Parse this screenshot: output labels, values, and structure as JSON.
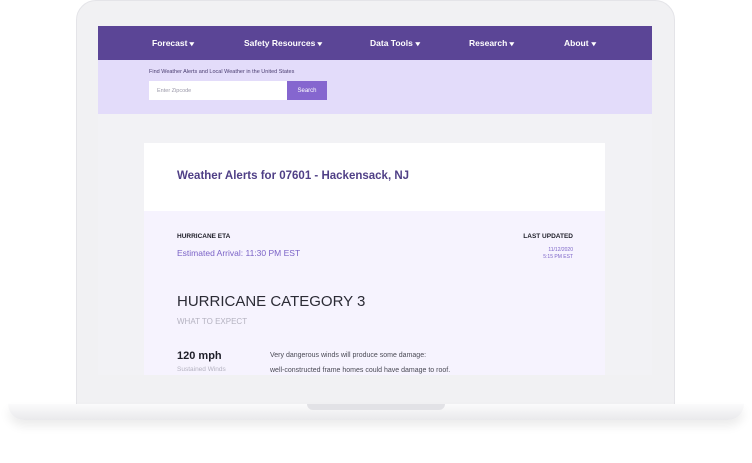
{
  "nav": {
    "items": [
      {
        "label": "Forecast"
      },
      {
        "label": "Safety Resources"
      },
      {
        "label": "Data Tools"
      },
      {
        "label": "Research"
      },
      {
        "label": "About"
      }
    ],
    "chevron": "▾"
  },
  "search": {
    "caption": "Find Weather Alerts and Local Weather in the United States",
    "placeholder": "Enter Zipcode",
    "button_label": "Search"
  },
  "alert": {
    "title": "Weather Alerts for 07601 - Hackensack, NJ",
    "eta_label": "HURRICANE ETA",
    "eta_value": "Estimated Arrival:  11:30  PM EST",
    "updated_label": "LAST UPDATED",
    "updated_date": "11/12/2020",
    "updated_time": "5:15 PM EST",
    "category_title": "HURRICANE CATEGORY 3",
    "category_subtitle": "WHAT TO EXPECT",
    "wind_value": "120 mph",
    "wind_caption": "Sustained Winds",
    "wind_desc_line1": "Very dangerous winds will produce some damage:",
    "wind_desc_line2": "well-constructed frame homes could have damage to roof."
  },
  "colors": {
    "nav_bg": "#5b4596",
    "search_band": "#e3dcfa",
    "accent": "#8566cf",
    "title": "#4f3f86"
  }
}
